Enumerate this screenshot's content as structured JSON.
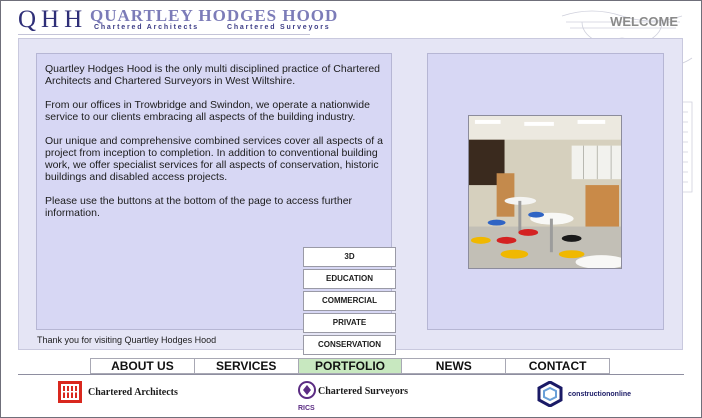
{
  "header": {
    "monogram": "QHH",
    "firm_name": "QUARTLEY HODGES HOOD",
    "subtitle_left": "Chartered Architects",
    "subtitle_right": "Chartered Surveyors",
    "welcome": "WELCOME"
  },
  "intro": {
    "paragraphs": [
      "Quartley Hodges Hood is the only multi disciplined practice of Chartered Architects and Chartered Surveyors in West Wiltshire.",
      "From our offices in Trowbridge and Swindon, we operate a nationwide service to our clients embracing all aspects of the building industry.",
      "Our unique and comprehensive combined services cover all aspects of a project from inception to completion. In addition to conventional building work, we offer specialist services for all aspects of conservation, historic buildings and disabled access projects.",
      "Please use the buttons at the bottom of the page to access further information."
    ],
    "thanks": "Thank you for visiting Quartley Hodges Hood"
  },
  "portfolio_menu": [
    "3D",
    "EDUCATION",
    "COMMERCIAL",
    "PRIVATE",
    "CONSERVATION"
  ],
  "nav": {
    "items": [
      "ABOUT US",
      "SERVICES",
      "PORTFOLIO",
      "NEWS",
      "CONTACT"
    ],
    "active": "PORTFOLIO"
  },
  "footer": {
    "architects_label": "Chartered Architects",
    "surveyors_label": "Chartered Surveyors",
    "rics_text": "RICS",
    "construction_label": "constructiononline"
  },
  "colors": {
    "panel": "#e5e5f5",
    "text_panel": "#d7d7f4",
    "nav_active": "#c8e8c0",
    "brand_blue": "#2f2f78",
    "riba_red": "#d9281e",
    "rics_purple": "#5b2c83"
  },
  "icons": [
    "riba-logo-icon",
    "rics-logo-icon",
    "construction-online-logo-icon"
  ]
}
